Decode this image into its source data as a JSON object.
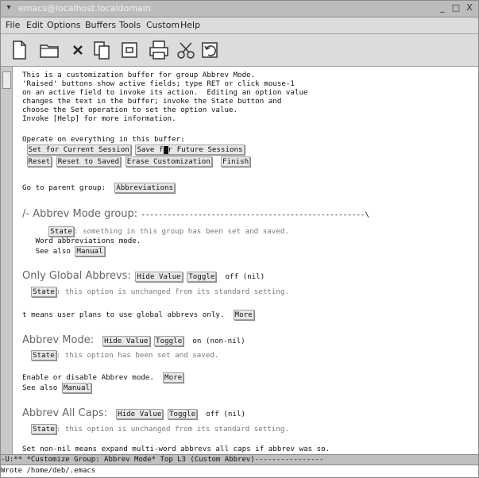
{
  "window": {
    "title": "emacs@localhost.localdomain",
    "controls": [
      "_",
      "□",
      "X"
    ]
  },
  "menubar": {
    "items": [
      "File",
      "Edit",
      "Options",
      "Buffers",
      "Tools",
      "Custom",
      "Help"
    ]
  },
  "toolbar": {
    "icons": [
      "new-file-icon",
      "open-folder-icon",
      "close-icon",
      "copy-icon",
      "paste-icon",
      "print-icon",
      "cut-icon",
      "undo-icon"
    ]
  },
  "editor": {
    "intro_lines": [
      "This is a customization buffer for group Abbrev Mode.",
      "'Raised' buttons show active fields; type RET or click mouse-1",
      "on an active field to invoke its action.  Editing an option value",
      "changes the text in the buffer; invoke the State button and",
      "choose the Set operation to set the option value.",
      "Invoke [Help] for more information."
    ],
    "operate_line": "Operate on everything in this buffer:",
    "buttons_row1": [
      "Set for Current Session",
      "Save for Future Sessions"
    ],
    "buttons_row2": [
      "Reset",
      "Reset to Saved",
      "Erase Customization",
      "Finish"
    ],
    "goto_parent": {
      "prefix": "Go to parent group:",
      "button": "Abbreviations"
    },
    "group": {
      "header": "/- Abbrev Mode group: ",
      "dashes": "---------------------------------------------------\\",
      "state_button": "State",
      "state_text": ": something in this group has been set and saved.",
      "desc": "Word abbreviations mode.",
      "see_also": "See also",
      "manual": "Manual"
    },
    "option1": {
      "name": "Only Global Abbrevs:",
      "hide": "Hide Value",
      "toggle": "Toggle",
      "value": "off (nil)",
      "state": "State",
      "state_text": ": this option is unchanged from its standard setting.",
      "desc": "t means user plans to use global abbrevs only.",
      "more": "More"
    },
    "option2": {
      "name": "Abbrev Mode:",
      "hide": "Hide Value",
      "toggle": "Toggle",
      "value": "on (non-nil)",
      "state": "State",
      "state_text": ": this option has been set and saved.",
      "desc": "Enable or disable Abbrev mode.",
      "more": "More",
      "see_also": "See also",
      "manual": "Manual"
    },
    "option3": {
      "name": "Abbrev All Caps:",
      "hide": "Hide Value",
      "toggle": "Toggle",
      "value": "off (nil)",
      "state": "State",
      "state_text": ": this option is unchanged from its standard setting.",
      "desc": "Set non-nil means expand multi-word abbrevs all caps if abbrev was so."
    }
  },
  "modeline": {
    "text": "-U:** *Customize Group: Abbrev Mode*   Top L3   (Custom Abbrev)----------------"
  },
  "minibuffer": {
    "text": "Wrote /home/deb/.emacs"
  }
}
